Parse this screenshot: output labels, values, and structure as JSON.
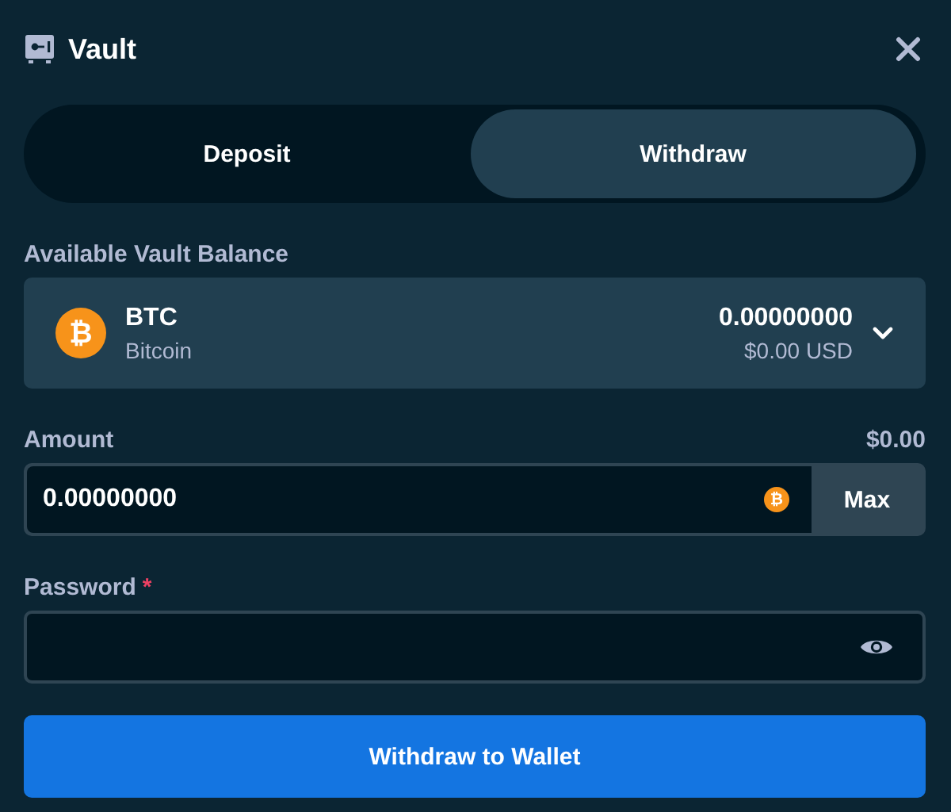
{
  "window": {
    "title": "Vault"
  },
  "tabs": [
    {
      "label": "Deposit",
      "selected": false
    },
    {
      "label": "Withdraw",
      "selected": true
    }
  ],
  "balance": {
    "label": "Available Vault Balance",
    "currency_icon": "₿",
    "code": "BTC",
    "name": "Bitcoin",
    "amount": "0.00000000",
    "usd": "$0.00 USD"
  },
  "amount": {
    "label": "Amount",
    "fiat": "$0.00",
    "value": "0.00000000",
    "currency_icon": "₿",
    "max_button": "Max"
  },
  "password": {
    "label": "Password",
    "required_mark": "*"
  },
  "submit_button": "Withdraw to Wallet"
}
